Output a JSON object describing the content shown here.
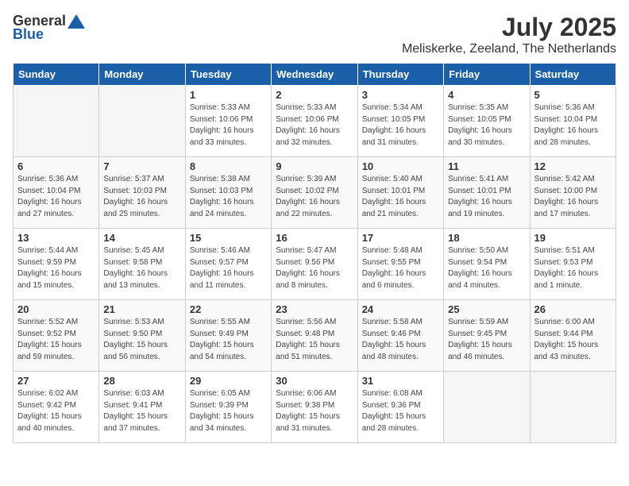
{
  "header": {
    "logo_general": "General",
    "logo_blue": "Blue",
    "month": "July 2025",
    "location": "Meliskerke, Zeeland, The Netherlands"
  },
  "weekdays": [
    "Sunday",
    "Monday",
    "Tuesday",
    "Wednesday",
    "Thursday",
    "Friday",
    "Saturday"
  ],
  "weeks": [
    [
      {
        "day": "",
        "detail": ""
      },
      {
        "day": "",
        "detail": ""
      },
      {
        "day": "1",
        "detail": "Sunrise: 5:33 AM\nSunset: 10:06 PM\nDaylight: 16 hours\nand 33 minutes."
      },
      {
        "day": "2",
        "detail": "Sunrise: 5:33 AM\nSunset: 10:06 PM\nDaylight: 16 hours\nand 32 minutes."
      },
      {
        "day": "3",
        "detail": "Sunrise: 5:34 AM\nSunset: 10:05 PM\nDaylight: 16 hours\nand 31 minutes."
      },
      {
        "day": "4",
        "detail": "Sunrise: 5:35 AM\nSunset: 10:05 PM\nDaylight: 16 hours\nand 30 minutes."
      },
      {
        "day": "5",
        "detail": "Sunrise: 5:36 AM\nSunset: 10:04 PM\nDaylight: 16 hours\nand 28 minutes."
      }
    ],
    [
      {
        "day": "6",
        "detail": "Sunrise: 5:36 AM\nSunset: 10:04 PM\nDaylight: 16 hours\nand 27 minutes."
      },
      {
        "day": "7",
        "detail": "Sunrise: 5:37 AM\nSunset: 10:03 PM\nDaylight: 16 hours\nand 25 minutes."
      },
      {
        "day": "8",
        "detail": "Sunrise: 5:38 AM\nSunset: 10:03 PM\nDaylight: 16 hours\nand 24 minutes."
      },
      {
        "day": "9",
        "detail": "Sunrise: 5:39 AM\nSunset: 10:02 PM\nDaylight: 16 hours\nand 22 minutes."
      },
      {
        "day": "10",
        "detail": "Sunrise: 5:40 AM\nSunset: 10:01 PM\nDaylight: 16 hours\nand 21 minutes."
      },
      {
        "day": "11",
        "detail": "Sunrise: 5:41 AM\nSunset: 10:01 PM\nDaylight: 16 hours\nand 19 minutes."
      },
      {
        "day": "12",
        "detail": "Sunrise: 5:42 AM\nSunset: 10:00 PM\nDaylight: 16 hours\nand 17 minutes."
      }
    ],
    [
      {
        "day": "13",
        "detail": "Sunrise: 5:44 AM\nSunset: 9:59 PM\nDaylight: 16 hours\nand 15 minutes."
      },
      {
        "day": "14",
        "detail": "Sunrise: 5:45 AM\nSunset: 9:58 PM\nDaylight: 16 hours\nand 13 minutes."
      },
      {
        "day": "15",
        "detail": "Sunrise: 5:46 AM\nSunset: 9:57 PM\nDaylight: 16 hours\nand 11 minutes."
      },
      {
        "day": "16",
        "detail": "Sunrise: 5:47 AM\nSunset: 9:56 PM\nDaylight: 16 hours\nand 8 minutes."
      },
      {
        "day": "17",
        "detail": "Sunrise: 5:48 AM\nSunset: 9:55 PM\nDaylight: 16 hours\nand 6 minutes."
      },
      {
        "day": "18",
        "detail": "Sunrise: 5:50 AM\nSunset: 9:54 PM\nDaylight: 16 hours\nand 4 minutes."
      },
      {
        "day": "19",
        "detail": "Sunrise: 5:51 AM\nSunset: 9:53 PM\nDaylight: 16 hours\nand 1 minute."
      }
    ],
    [
      {
        "day": "20",
        "detail": "Sunrise: 5:52 AM\nSunset: 9:52 PM\nDaylight: 15 hours\nand 59 minutes."
      },
      {
        "day": "21",
        "detail": "Sunrise: 5:53 AM\nSunset: 9:50 PM\nDaylight: 15 hours\nand 56 minutes."
      },
      {
        "day": "22",
        "detail": "Sunrise: 5:55 AM\nSunset: 9:49 PM\nDaylight: 15 hours\nand 54 minutes."
      },
      {
        "day": "23",
        "detail": "Sunrise: 5:56 AM\nSunset: 9:48 PM\nDaylight: 15 hours\nand 51 minutes."
      },
      {
        "day": "24",
        "detail": "Sunrise: 5:58 AM\nSunset: 9:46 PM\nDaylight: 15 hours\nand 48 minutes."
      },
      {
        "day": "25",
        "detail": "Sunrise: 5:59 AM\nSunset: 9:45 PM\nDaylight: 15 hours\nand 46 minutes."
      },
      {
        "day": "26",
        "detail": "Sunrise: 6:00 AM\nSunset: 9:44 PM\nDaylight: 15 hours\nand 43 minutes."
      }
    ],
    [
      {
        "day": "27",
        "detail": "Sunrise: 6:02 AM\nSunset: 9:42 PM\nDaylight: 15 hours\nand 40 minutes."
      },
      {
        "day": "28",
        "detail": "Sunrise: 6:03 AM\nSunset: 9:41 PM\nDaylight: 15 hours\nand 37 minutes."
      },
      {
        "day": "29",
        "detail": "Sunrise: 6:05 AM\nSunset: 9:39 PM\nDaylight: 15 hours\nand 34 minutes."
      },
      {
        "day": "30",
        "detail": "Sunrise: 6:06 AM\nSunset: 9:38 PM\nDaylight: 15 hours\nand 31 minutes."
      },
      {
        "day": "31",
        "detail": "Sunrise: 6:08 AM\nSunset: 9:36 PM\nDaylight: 15 hours\nand 28 minutes."
      },
      {
        "day": "",
        "detail": ""
      },
      {
        "day": "",
        "detail": ""
      }
    ]
  ]
}
